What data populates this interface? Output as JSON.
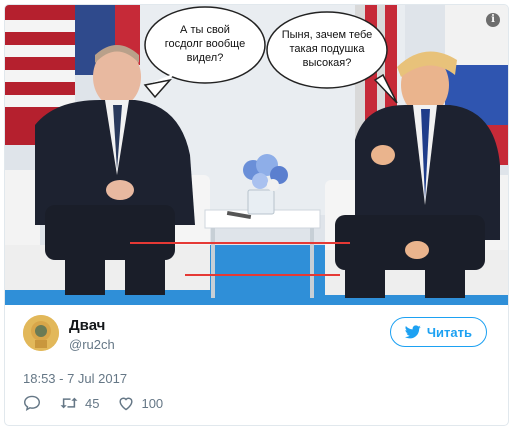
{
  "bubbles": {
    "left": [
      "А ты свой",
      "госдолг вообще",
      "видел?"
    ],
    "right": [
      "Пыня, зачем тебе",
      "такая подушка",
      "высокая?"
    ]
  },
  "info_glyph": "i",
  "author": {
    "display_name": "Двач",
    "handle": "@ru2ch"
  },
  "follow": {
    "label": "Читать",
    "icon": "twitter-bird-icon"
  },
  "timestamp": "18:53 - 7 Jul 2017",
  "actions": {
    "retweets": "45",
    "likes": "100"
  },
  "colors": {
    "accent": "#1da1f2",
    "highlight_line": "#e53935"
  }
}
